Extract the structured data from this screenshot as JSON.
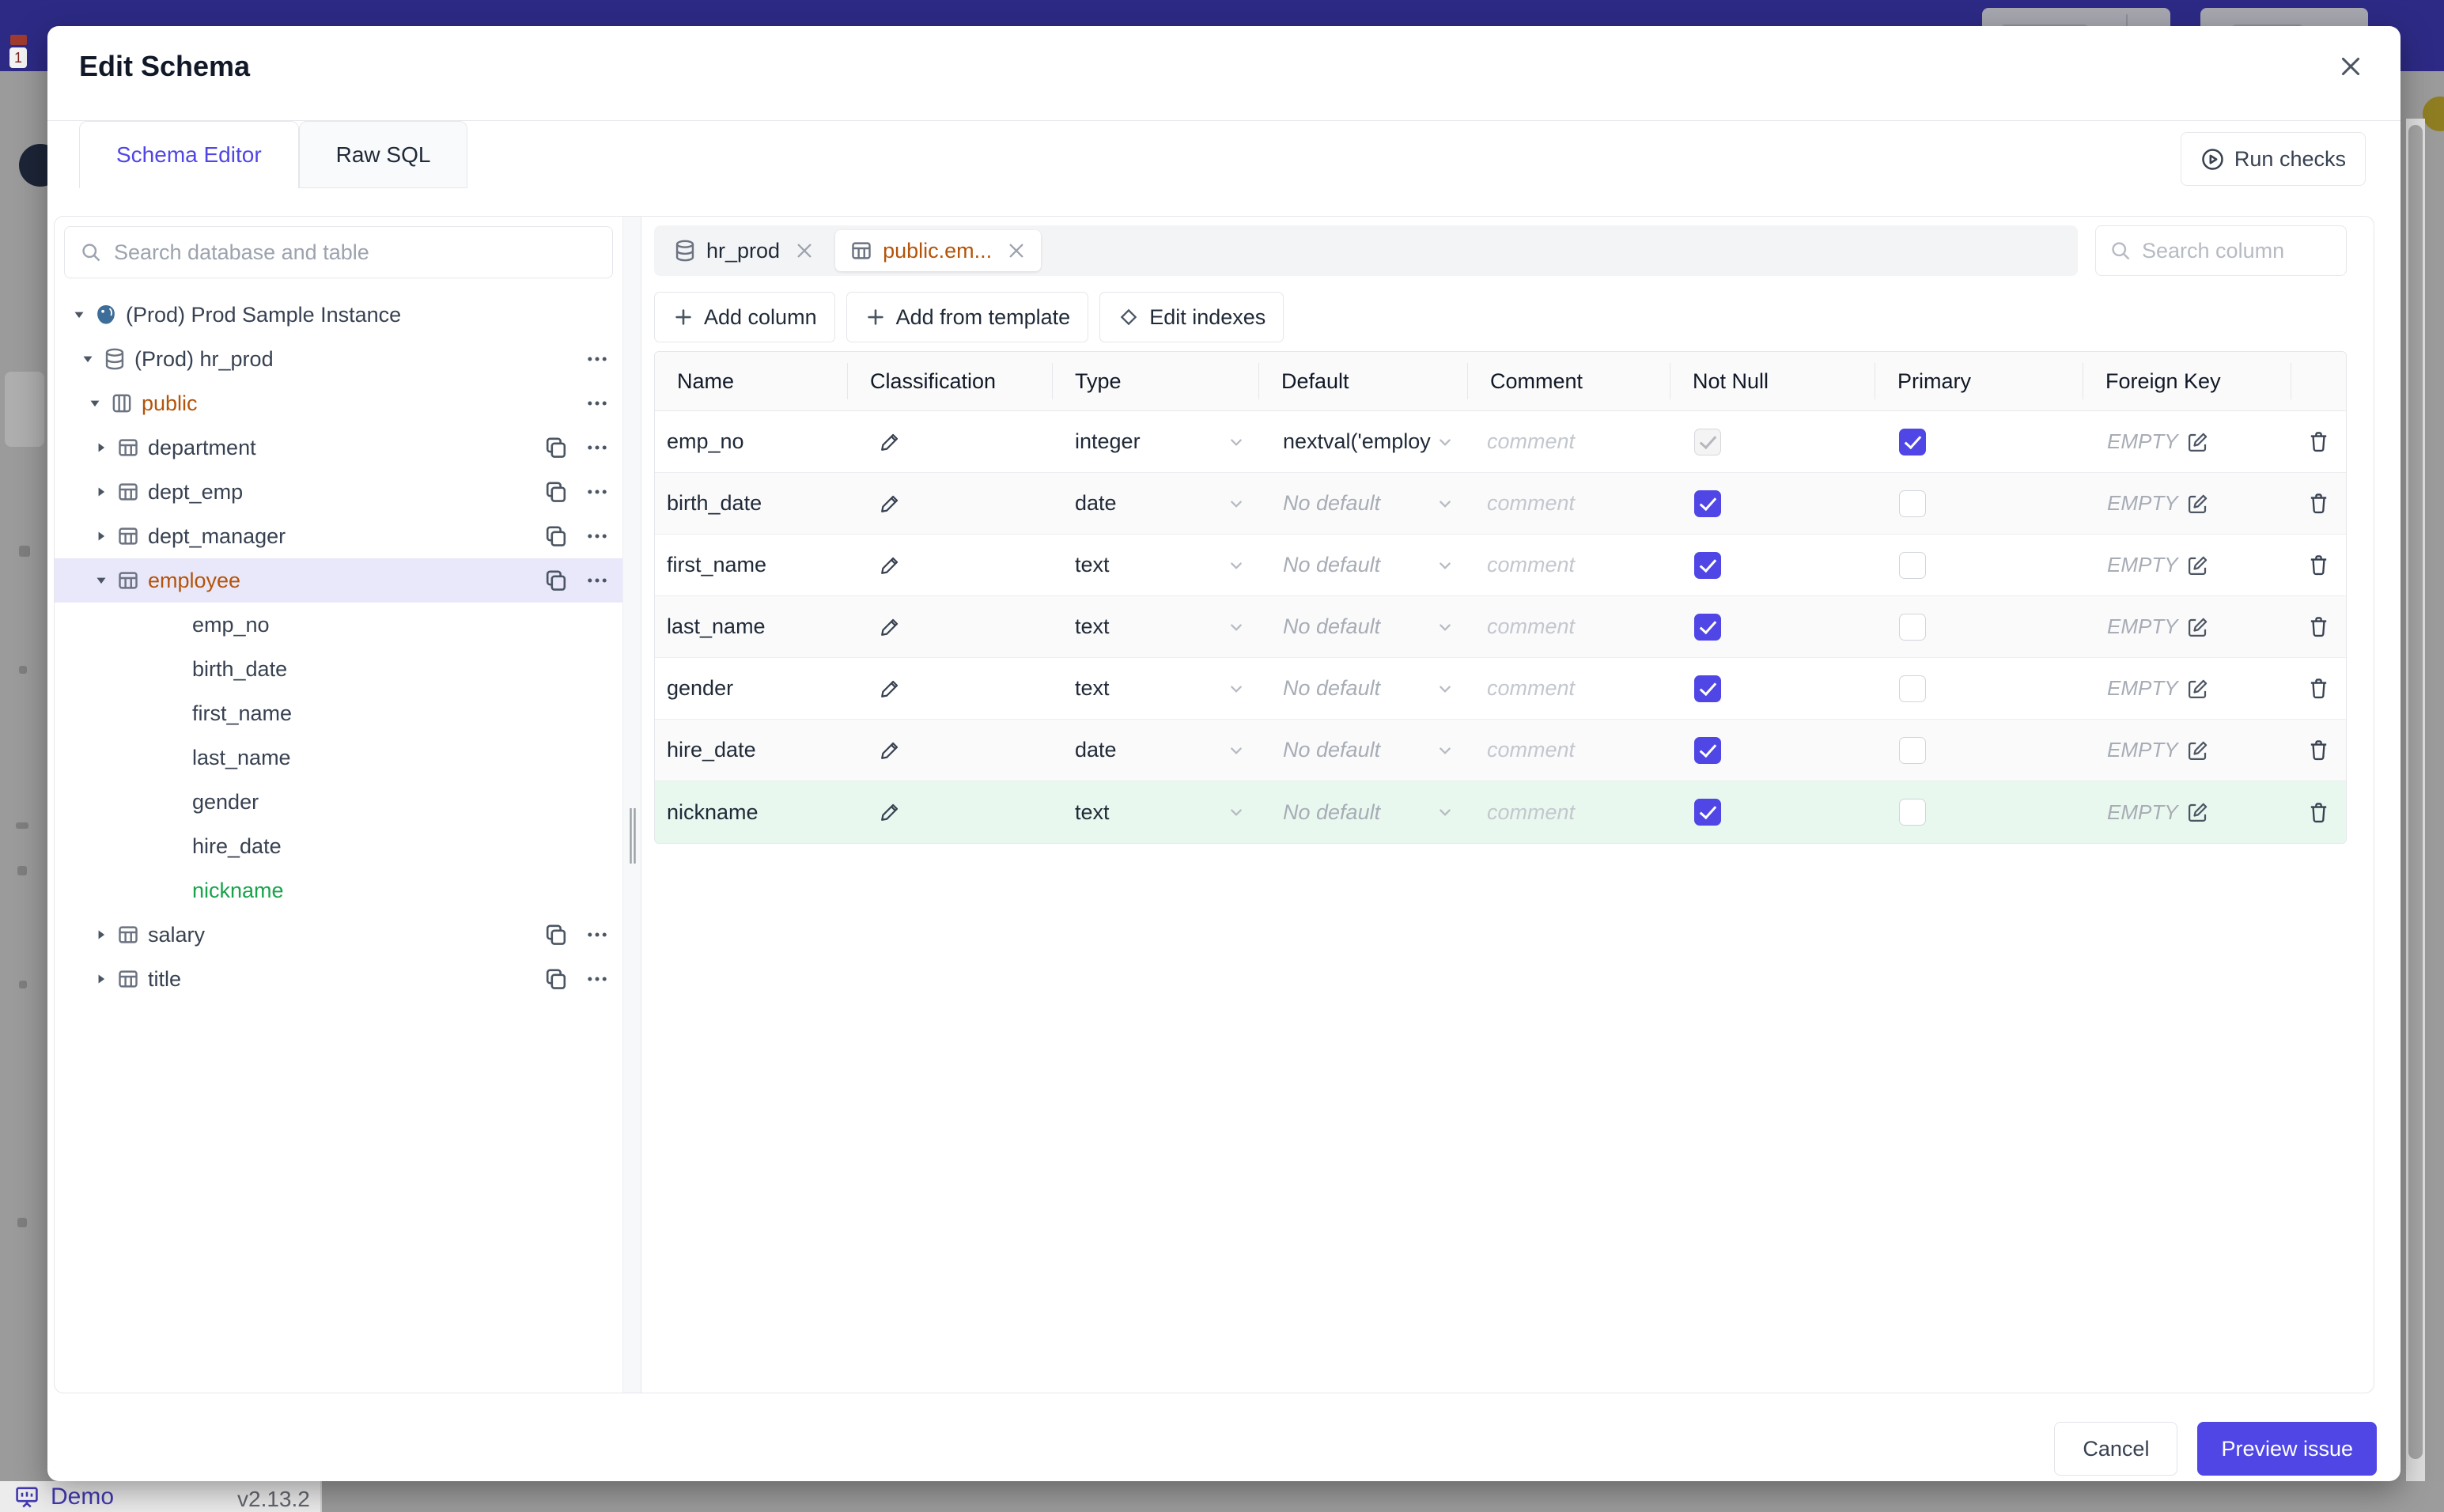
{
  "backdrop": {
    "top_bar_color": "#2d2a86",
    "badge_text": "1",
    "demo_label": "Demo",
    "version_label": "v2.13.2"
  },
  "modal": {
    "title": "Edit Schema",
    "close_icon": "close-icon",
    "tabs": [
      {
        "label": "Schema Editor",
        "cls": "active"
      },
      {
        "label": "Raw SQL",
        "cls": ""
      }
    ],
    "run_checks_label": "Run checks",
    "accent_color": "#4f46e5",
    "amber_color": "#b45309",
    "green_color": "#16a34a",
    "sidebar": {
      "search_placeholder": "Search database and table",
      "tree": [
        {
          "cls": "lvl1 chev-down icon-pg",
          "label": "(Prod) Prod Sample Instance",
          "label_cls": ""
        },
        {
          "cls": "lvl2 chev-down icon-db t-dots",
          "label": "(Prod) hr_prod",
          "label_cls": ""
        },
        {
          "cls": "lvl3 chev-down icon-schema t-dots",
          "label": "public",
          "label_cls": "amber"
        },
        {
          "cls": "lvl4 chev-right icon-table t-copy-dots",
          "label": "department",
          "label_cls": ""
        },
        {
          "cls": "lvl4 chev-right icon-table t-copy-dots",
          "label": "dept_emp",
          "label_cls": ""
        },
        {
          "cls": "lvl4 chev-right icon-table t-copy-dots",
          "label": "dept_manager",
          "label_cls": ""
        },
        {
          "cls": "lvl4 chev-down icon-table t-copy-dots sel",
          "label": "employee",
          "label_cls": "amber"
        },
        {
          "cls": "lvl5",
          "label": "emp_no",
          "label_cls": ""
        },
        {
          "cls": "lvl5",
          "label": "birth_date",
          "label_cls": ""
        },
        {
          "cls": "lvl5",
          "label": "first_name",
          "label_cls": ""
        },
        {
          "cls": "lvl5",
          "label": "last_name",
          "label_cls": ""
        },
        {
          "cls": "lvl5",
          "label": "gender",
          "label_cls": ""
        },
        {
          "cls": "lvl5",
          "label": "hire_date",
          "label_cls": ""
        },
        {
          "cls": "lvl5",
          "label": "nickname",
          "label_cls": "green"
        },
        {
          "cls": "lvl4 chev-right icon-table t-copy-dots",
          "label": "salary",
          "label_cls": ""
        },
        {
          "cls": "lvl4 chev-right icon-table t-copy-dots",
          "label": "title",
          "label_cls": ""
        }
      ]
    },
    "main": {
      "chips": [
        {
          "cls": "icon-db",
          "label": "hr_prod"
        },
        {
          "cls": "icon-table active",
          "label": "public.em..."
        }
      ],
      "column_search_placeholder": "Search column",
      "toolbar": [
        {
          "cls": "icon-plus",
          "label": "Add column"
        },
        {
          "cls": "icon-plus",
          "label": "Add from template"
        },
        {
          "cls": "icon-diamond",
          "label": "Edit indexes"
        }
      ],
      "table": {
        "headers": [
          {
            "label": "Name"
          },
          {
            "label": "Classification"
          },
          {
            "label": "Type"
          },
          {
            "label": "Default"
          },
          {
            "label": "Comment"
          },
          {
            "label": "Not Null"
          },
          {
            "label": "Primary"
          },
          {
            "label": "Foreign Key"
          },
          {
            "label": ""
          }
        ],
        "comment_placeholder": "comment",
        "fk_empty_label": "EMPTY",
        "rows": [
          {
            "name": "emp_no",
            "type": "integer",
            "dflt": "nextval('employ",
            "dflt_cls": "val",
            "nn_cls": "checked disabled",
            "pk_cls": "checked",
            "row_cls": ""
          },
          {
            "name": "birth_date",
            "type": "date",
            "dflt": "No default",
            "dflt_cls": "ph",
            "nn_cls": "checked",
            "pk_cls": "",
            "row_cls": "alt"
          },
          {
            "name": "first_name",
            "type": "text",
            "dflt": "No default",
            "dflt_cls": "ph",
            "nn_cls": "checked",
            "pk_cls": "",
            "row_cls": ""
          },
          {
            "name": "last_name",
            "type": "text",
            "dflt": "No default",
            "dflt_cls": "ph",
            "nn_cls": "checked",
            "pk_cls": "",
            "row_cls": "alt"
          },
          {
            "name": "gender",
            "type": "text",
            "dflt": "No default",
            "dflt_cls": "ph",
            "nn_cls": "checked",
            "pk_cls": "",
            "row_cls": ""
          },
          {
            "name": "hire_date",
            "type": "date",
            "dflt": "No default",
            "dflt_cls": "ph",
            "nn_cls": "checked",
            "pk_cls": "",
            "row_cls": "alt"
          },
          {
            "name": "nickname",
            "type": "text",
            "dflt": "No default",
            "dflt_cls": "ph",
            "nn_cls": "checked",
            "pk_cls": "",
            "row_cls": "green"
          }
        ]
      }
    },
    "footer": {
      "cancel_label": "Cancel",
      "primary_label": "Preview issue"
    }
  }
}
